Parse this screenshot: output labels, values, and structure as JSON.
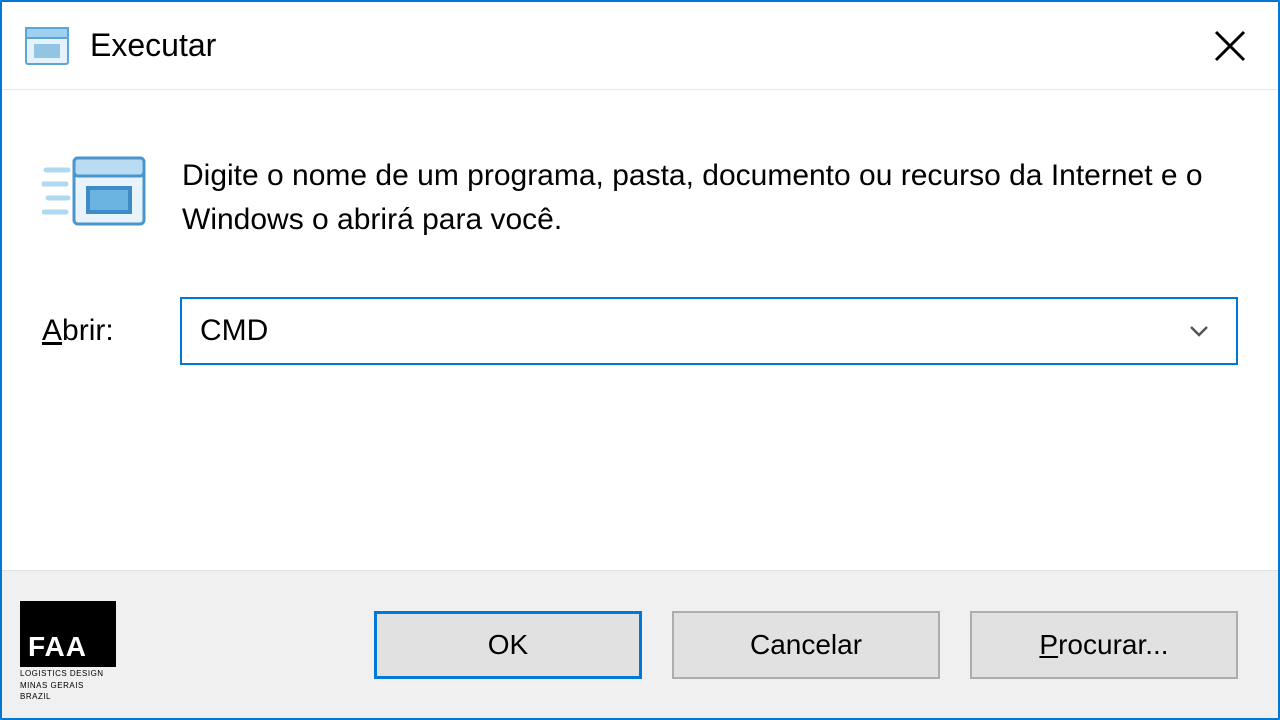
{
  "window": {
    "title": "Executar",
    "prompt": "Digite o nome de um programa, pasta, documento ou recurso da Internet e o Windows o abrirá para você.",
    "input_label_prefix": "A",
    "input_label_rest": "brir:",
    "input_value": "CMD",
    "buttons": {
      "ok": "OK",
      "cancel": "Cancelar",
      "browse_prefix": "P",
      "browse_rest": "rocurar..."
    }
  },
  "watermark": {
    "logo": "FAA",
    "line1": "LOGISTICS DESIGN",
    "line2": "MINAS GERAIS",
    "line3": "BRAZIL"
  }
}
